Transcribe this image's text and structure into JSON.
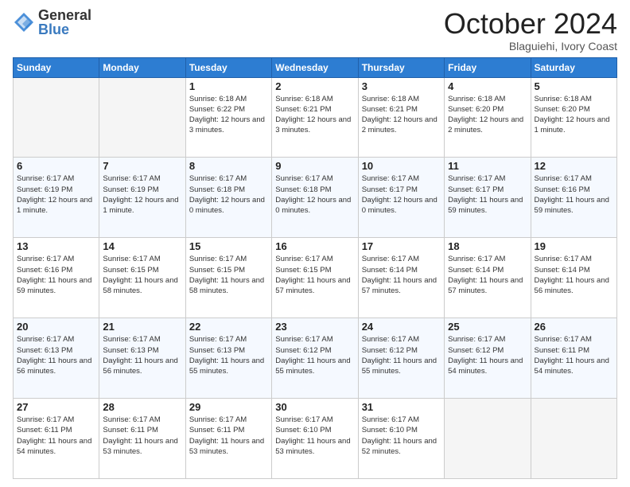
{
  "logo": {
    "general": "General",
    "blue": "Blue"
  },
  "title": "October 2024",
  "subtitle": "Blaguiehi, Ivory Coast",
  "headers": [
    "Sunday",
    "Monday",
    "Tuesday",
    "Wednesday",
    "Thursday",
    "Friday",
    "Saturday"
  ],
  "weeks": [
    [
      {
        "day": "",
        "info": ""
      },
      {
        "day": "",
        "info": ""
      },
      {
        "day": "1",
        "info": "Sunrise: 6:18 AM\nSunset: 6:22 PM\nDaylight: 12 hours and 3 minutes."
      },
      {
        "day": "2",
        "info": "Sunrise: 6:18 AM\nSunset: 6:21 PM\nDaylight: 12 hours and 3 minutes."
      },
      {
        "day": "3",
        "info": "Sunrise: 6:18 AM\nSunset: 6:21 PM\nDaylight: 12 hours and 2 minutes."
      },
      {
        "day": "4",
        "info": "Sunrise: 6:18 AM\nSunset: 6:20 PM\nDaylight: 12 hours and 2 minutes."
      },
      {
        "day": "5",
        "info": "Sunrise: 6:18 AM\nSunset: 6:20 PM\nDaylight: 12 hours and 1 minute."
      }
    ],
    [
      {
        "day": "6",
        "info": "Sunrise: 6:17 AM\nSunset: 6:19 PM\nDaylight: 12 hours and 1 minute."
      },
      {
        "day": "7",
        "info": "Sunrise: 6:17 AM\nSunset: 6:19 PM\nDaylight: 12 hours and 1 minute."
      },
      {
        "day": "8",
        "info": "Sunrise: 6:17 AM\nSunset: 6:18 PM\nDaylight: 12 hours and 0 minutes."
      },
      {
        "day": "9",
        "info": "Sunrise: 6:17 AM\nSunset: 6:18 PM\nDaylight: 12 hours and 0 minutes."
      },
      {
        "day": "10",
        "info": "Sunrise: 6:17 AM\nSunset: 6:17 PM\nDaylight: 12 hours and 0 minutes."
      },
      {
        "day": "11",
        "info": "Sunrise: 6:17 AM\nSunset: 6:17 PM\nDaylight: 11 hours and 59 minutes."
      },
      {
        "day": "12",
        "info": "Sunrise: 6:17 AM\nSunset: 6:16 PM\nDaylight: 11 hours and 59 minutes."
      }
    ],
    [
      {
        "day": "13",
        "info": "Sunrise: 6:17 AM\nSunset: 6:16 PM\nDaylight: 11 hours and 59 minutes."
      },
      {
        "day": "14",
        "info": "Sunrise: 6:17 AM\nSunset: 6:15 PM\nDaylight: 11 hours and 58 minutes."
      },
      {
        "day": "15",
        "info": "Sunrise: 6:17 AM\nSunset: 6:15 PM\nDaylight: 11 hours and 58 minutes."
      },
      {
        "day": "16",
        "info": "Sunrise: 6:17 AM\nSunset: 6:15 PM\nDaylight: 11 hours and 57 minutes."
      },
      {
        "day": "17",
        "info": "Sunrise: 6:17 AM\nSunset: 6:14 PM\nDaylight: 11 hours and 57 minutes."
      },
      {
        "day": "18",
        "info": "Sunrise: 6:17 AM\nSunset: 6:14 PM\nDaylight: 11 hours and 57 minutes."
      },
      {
        "day": "19",
        "info": "Sunrise: 6:17 AM\nSunset: 6:14 PM\nDaylight: 11 hours and 56 minutes."
      }
    ],
    [
      {
        "day": "20",
        "info": "Sunrise: 6:17 AM\nSunset: 6:13 PM\nDaylight: 11 hours and 56 minutes."
      },
      {
        "day": "21",
        "info": "Sunrise: 6:17 AM\nSunset: 6:13 PM\nDaylight: 11 hours and 56 minutes."
      },
      {
        "day": "22",
        "info": "Sunrise: 6:17 AM\nSunset: 6:13 PM\nDaylight: 11 hours and 55 minutes."
      },
      {
        "day": "23",
        "info": "Sunrise: 6:17 AM\nSunset: 6:12 PM\nDaylight: 11 hours and 55 minutes."
      },
      {
        "day": "24",
        "info": "Sunrise: 6:17 AM\nSunset: 6:12 PM\nDaylight: 11 hours and 55 minutes."
      },
      {
        "day": "25",
        "info": "Sunrise: 6:17 AM\nSunset: 6:12 PM\nDaylight: 11 hours and 54 minutes."
      },
      {
        "day": "26",
        "info": "Sunrise: 6:17 AM\nSunset: 6:11 PM\nDaylight: 11 hours and 54 minutes."
      }
    ],
    [
      {
        "day": "27",
        "info": "Sunrise: 6:17 AM\nSunset: 6:11 PM\nDaylight: 11 hours and 54 minutes."
      },
      {
        "day": "28",
        "info": "Sunrise: 6:17 AM\nSunset: 6:11 PM\nDaylight: 11 hours and 53 minutes."
      },
      {
        "day": "29",
        "info": "Sunrise: 6:17 AM\nSunset: 6:11 PM\nDaylight: 11 hours and 53 minutes."
      },
      {
        "day": "30",
        "info": "Sunrise: 6:17 AM\nSunset: 6:10 PM\nDaylight: 11 hours and 53 minutes."
      },
      {
        "day": "31",
        "info": "Sunrise: 6:17 AM\nSunset: 6:10 PM\nDaylight: 11 hours and 52 minutes."
      },
      {
        "day": "",
        "info": ""
      },
      {
        "day": "",
        "info": ""
      }
    ]
  ]
}
